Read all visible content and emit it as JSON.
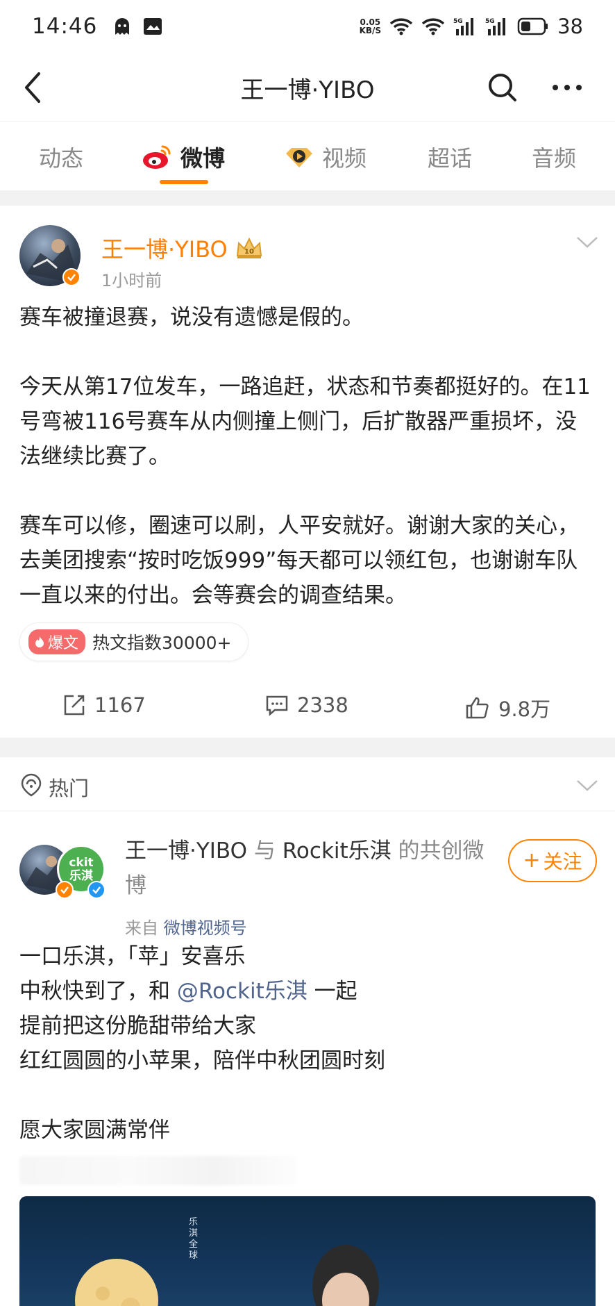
{
  "status_bar": {
    "time": "14:46",
    "speed_top": "0.05",
    "speed_bottom": "KB/S",
    "battery": "38"
  },
  "nav": {
    "title": "王一博·YIBO"
  },
  "tabs": [
    {
      "label": "动态"
    },
    {
      "label": "微博"
    },
    {
      "label": "视频"
    },
    {
      "label": "超话"
    },
    {
      "label": "音频"
    }
  ],
  "post1": {
    "username": "王一博·YIBO",
    "time": "1小时前",
    "paragraphs": [
      "赛车被撞退赛，说没有遗憾是假的。",
      "今天从第17位发车，一路追赶，状态和节奏都挺好的。在11号弯被116号赛车从内侧撞上侧门，后扩散器严重损坏，没法继续比赛了。",
      "赛车可以修，圈速可以刷，人平安就好。谢谢大家的关心，去美团搜索“按时吃饭999”每天都可以领红包，也谢谢车队一直以来的付出。会等赛会的调查结果。"
    ],
    "hot_badge": "爆文",
    "hot_index": "热文指数30000+",
    "repost_count": "1167",
    "comment_count": "2338",
    "like_count": "9.8万"
  },
  "hot_section": {
    "title": "热门"
  },
  "post2": {
    "author1": "王一博·YIBO",
    "with": "与",
    "author2": "Rockit乐淇",
    "suffix": "的共创微博",
    "follow": "关注",
    "from_label": "来自",
    "from_source": "微博视频号",
    "line1": "一口乐淇，「苹」安喜乐",
    "line2_pre": "中秋快到了，和",
    "line2_mention": "@Rockit乐淇",
    "line2_post": "一起",
    "line3": "提前把这份脆甜带给大家",
    "line4": "红红圆圆的小苹果，陪伴中秋团圆时刻",
    "line5": "愿大家圆满常伴",
    "avatar2_text": "ckit\n乐淇",
    "media_caption": "乐淇 全球"
  },
  "colors": {
    "accent": "#ff8200",
    "link": "#50648c",
    "hot_badge": "#f56a6a"
  }
}
